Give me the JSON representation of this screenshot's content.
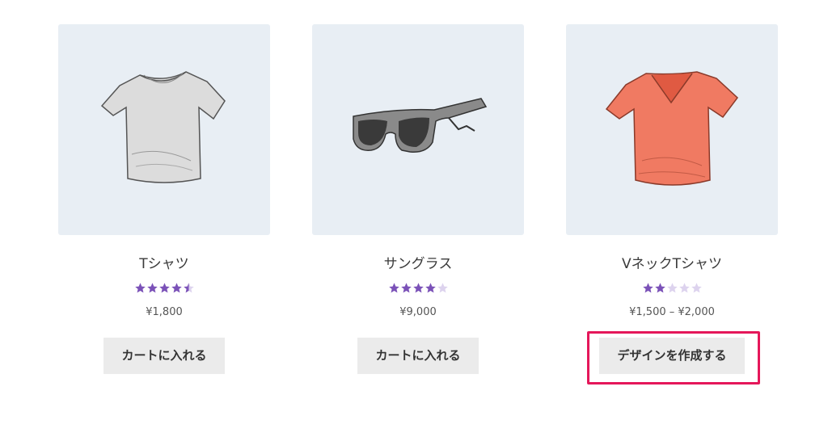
{
  "products": [
    {
      "name": "Tシャツ",
      "rating": 4.5,
      "price": "¥1,800",
      "button_label": "カートに入れる",
      "image": "white-tshirt"
    },
    {
      "name": "サングラス",
      "rating": 4,
      "price": "¥9,000",
      "button_label": "カートに入れる",
      "image": "sunglasses"
    },
    {
      "name": "VネックTシャツ",
      "rating": 2,
      "price": "¥1,500 – ¥2,000",
      "button_label": "デザインを作成する",
      "image": "coral-vneck-tshirt"
    }
  ],
  "colors": {
    "star_filled": "#7b52b8",
    "star_empty": "#ddd3ee",
    "highlight": "#e5175a",
    "thumb_bg": "#e8eef4"
  }
}
